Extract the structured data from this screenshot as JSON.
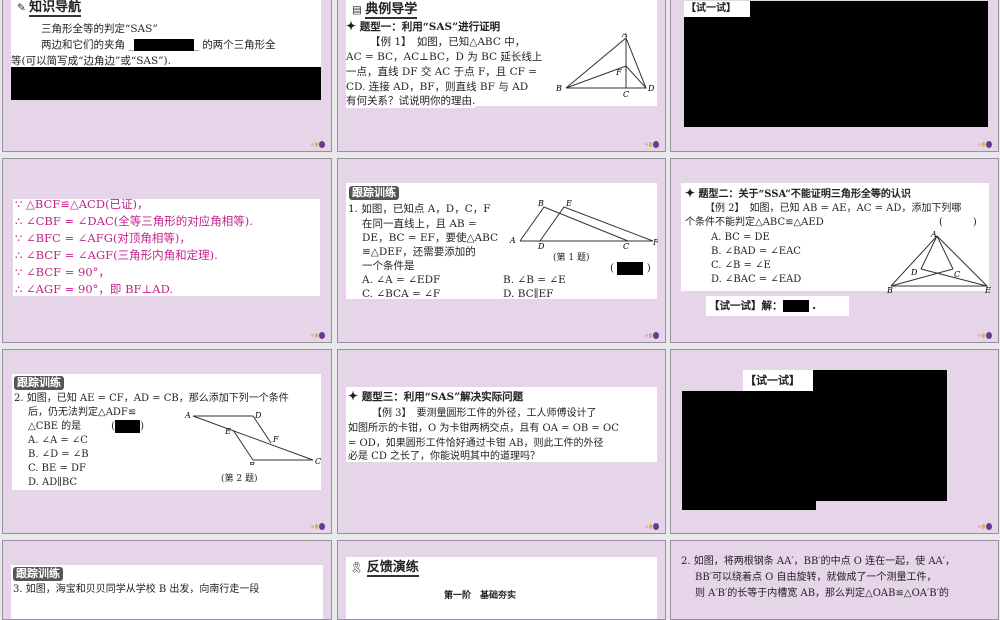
{
  "slides": [
    {
      "title": "知识导航",
      "lines": [
        "三角形全等的判定“SAS”",
        "两边和它们的夹角",
        "的两个三角形全",
        "等(可以简写成“边角边”或“SAS”)."
      ]
    },
    {
      "title": "典例导学",
      "heading": "题型一：利用“SAS”进行证明",
      "lines": [
        "【例 1】　如图，已知△ABC 中，",
        "AC = BC，AC⊥BC，D 为 BC 延长线上",
        "一点，直线 DF 交 AC 于点 F，且 CF =",
        "CD. 连接 AD，BF，则直线 BF 与 AD",
        "有何关系？试说明你的理由."
      ],
      "labels": [
        "A",
        "B",
        "C",
        "D",
        "F"
      ]
    },
    {
      "label": "【试一试】"
    },
    {
      "lines": [
        "∵ △BCF≌△ACD(已证)，",
        "∴ ∠CBF = ∠DAC(全等三角形的对应角相等).",
        "∵ ∠BFC = ∠AFG(对顶角相等)，",
        "∴ ∠BCF = ∠AGF(三角形内角和定理).",
        "∵ ∠BCF = 90°，",
        "∴ ∠AGF = 90°，即 BF⊥AD."
      ]
    },
    {
      "tag": "跟踪训练",
      "lines": [
        "1. 如图，已知点 A，D，C，F",
        "在同一直线上，且 AB =",
        "DE，BC = EF，要使△ABC",
        "≌△DEF，还需要添加的",
        "一个条件是"
      ],
      "options": [
        "A. ∠A = ∠EDF",
        "B. ∠B = ∠E",
        "C. ∠BCA = ∠F",
        "D. BC∥EF"
      ],
      "caption": "(第 1 题)",
      "paren_l": "(",
      "paren_r": ")",
      "labels": [
        "A",
        "B",
        "D",
        "E",
        "C",
        "F"
      ]
    },
    {
      "heading": "题型二：关于“SSA”不能证明三角形全等的认识",
      "lines": [
        "【例 2】　如图，已知 AB = AE，AC = AD，添加下列哪",
        "个条件不能判定△ABC≌△AED"
      ],
      "paren": "(　　　)",
      "options": [
        "A. BC = DE",
        "B. ∠BAD = ∠EAC",
        "C. ∠B = ∠E",
        "D. ∠BAC = ∠EAD"
      ],
      "answer_label": "【试一试】解：",
      "answer_end": ".",
      "labels": [
        "A",
        "B",
        "C",
        "D",
        "E"
      ]
    },
    {
      "tag": "跟踪训练",
      "lines": [
        "2. 如图，已知 AE = CF，AD = CB，那么添加下列一个条件",
        "后，仍无法判定△ADF≌",
        "△CBE 的是"
      ],
      "paren_l": "(",
      "paren_r": ")",
      "options": [
        "A. ∠A = ∠C",
        "B. ∠D = ∠B",
        "C. BE = DF",
        "D. AD∥BC"
      ],
      "caption": "(第 2 题)",
      "labels": [
        "A",
        "D",
        "E",
        "F",
        "B",
        "C"
      ]
    },
    {
      "heading": "题型三：利用“SAS”解决实际问题",
      "lines": [
        "【例 3】　要测量圆形工件的外径，工人师傅设计了",
        "如图所示的卡钳，O 为卡钳两柄交点，且有 OA = OB = OC",
        "= OD，如果圆形工件恰好通过卡钳 AB，则此工件的外径",
        "必是 CD 之长了，你能说明其中的道理吗？"
      ]
    },
    {
      "label": "【试一试】"
    },
    {
      "tag": "跟踪训练",
      "lines": [
        "3. 如图，海宝和贝贝同学从学校 B 出发，向南行走一段"
      ]
    },
    {
      "title": "反馈演练",
      "sub": "第一阶　基础夯实"
    },
    {
      "lines": [
        "2. 如图，将两根钢条 AA′，BB′的中点 O 连在一起，使 AA′，",
        "BB′可以绕着点 O 自由旋转，就做成了一个测量工件，",
        "则 A′B′的长等于内槽宽 AB，那么判定△OAB≌△OA′B′的"
      ]
    }
  ],
  "colors": {
    "slide_bg": "#e6d5e8",
    "proof_text": "#c2248c"
  }
}
